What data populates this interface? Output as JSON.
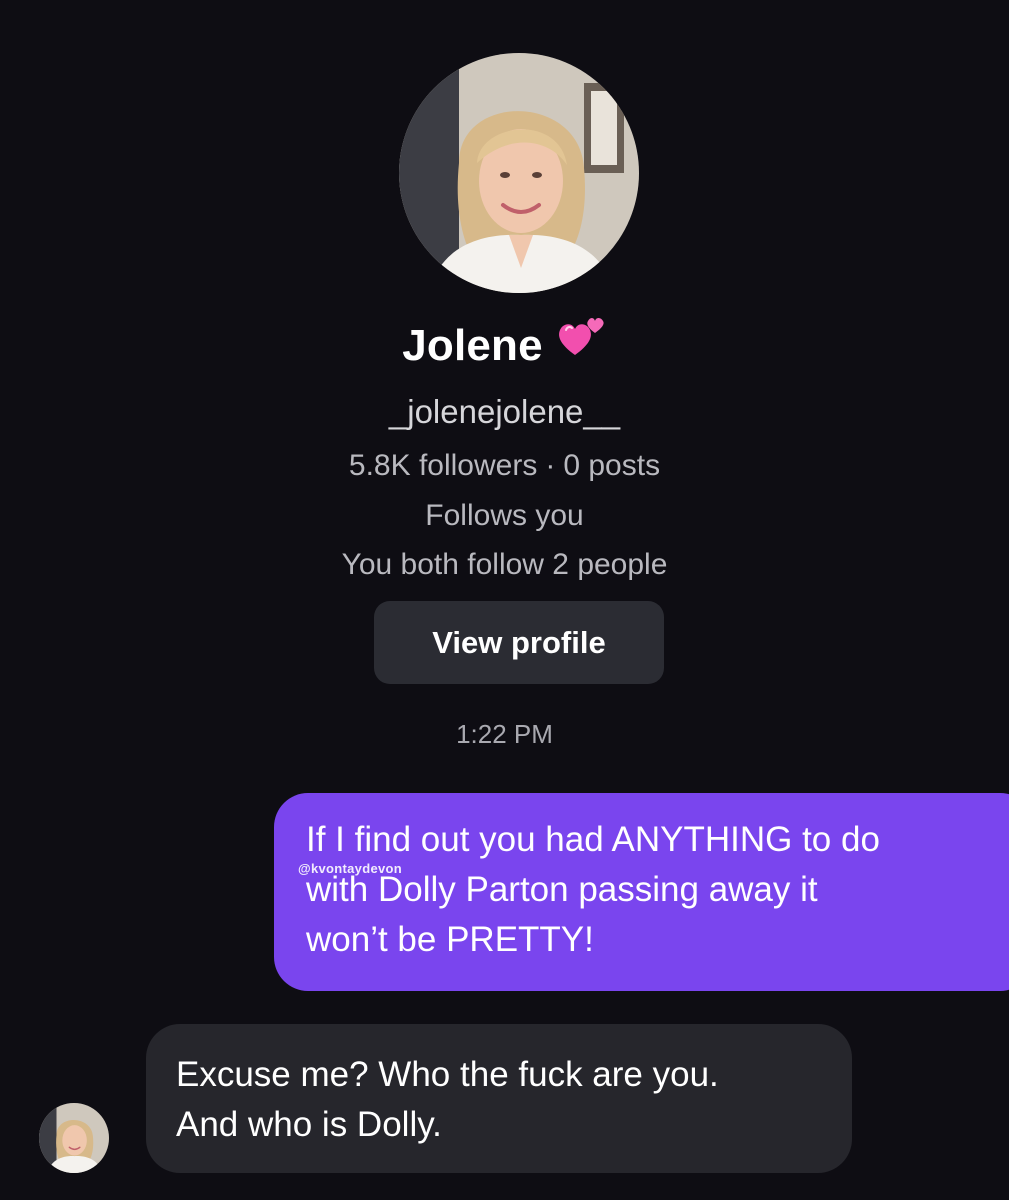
{
  "profile": {
    "name": "Jolene",
    "name_emoji_icon": "two-hearts-icon",
    "username": "_jolenejolene__",
    "followers": "5.8K followers",
    "separator": "·",
    "posts": "0 posts",
    "follows_you": "Follows you",
    "mutual": "You both follow 2 people",
    "view_profile_label": "View profile"
  },
  "conversation": {
    "timestamp": "1:22 PM",
    "messages": [
      {
        "sender": "me",
        "text": "If I find out you had ANYTHING to do\nwith Dolly Parton passing away it\nwon’t be PRETTY!"
      },
      {
        "sender": "them",
        "text": "Excuse me? Who the fuck are you.\nAnd who is Dolly."
      }
    ],
    "watermark": "@kvontaydevon"
  },
  "colors": {
    "background": "#0e0d13",
    "outgoing_bubble": "#7a45ee",
    "incoming_bubble": "#26262c",
    "button_bg": "#2b2c33",
    "heart_pink": "#f24fae"
  }
}
